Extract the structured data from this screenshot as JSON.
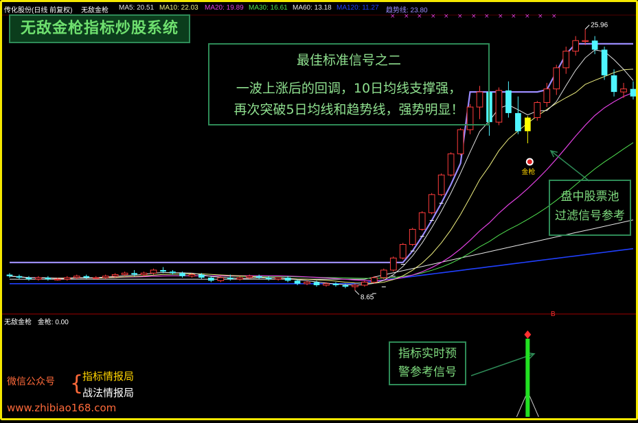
{
  "header": {
    "stock": "传化股份(日线 前复权)",
    "indicator": "无敌金枪",
    "ma5": "MA5: 20.51",
    "ma10": "MA10: 22.03",
    "ma20": "MA20: 19.89",
    "ma30": "MA30: 16.61",
    "ma60": "MA60: 13.18",
    "ma120": "MA120: 11.27",
    "trend": "趋势线: 23.80"
  },
  "sub_header": {
    "indicator": "无敌金枪",
    "value": "金枪: 0.00"
  },
  "title_banner": "无敌金枪指标炒股系统",
  "signal_box": {
    "title": "最佳标准信号之二",
    "line1": "一波上涨后的回调，10日均线支撑强，",
    "line2": "再次突破5日均线和趋势线，强势明显！"
  },
  "pool_box": {
    "line1": "盘中股票池",
    "line2": "过滤信号参考"
  },
  "warn_box": {
    "line1": "指标实时预",
    "line2": "警参考信号"
  },
  "promo": {
    "wechat": "微信公众号",
    "name1": "指标情报局",
    "name2": "战法情报局",
    "url": "www.zhibiao168.com"
  },
  "chart_data": {
    "type": "candlestick",
    "high_label": "25.96",
    "low_label": "8.65",
    "signal_label": "金枪",
    "sub_marker": "B",
    "colors": {
      "up": "#ff3c3c",
      "down": "#4ff5ff",
      "signal": "#ffff00",
      "ma5": "#e0e0e0",
      "ma10": "#f0f080",
      "ma20": "#e040e0",
      "ma30": "#50e050",
      "ma60": "#e8e8e8",
      "ma120": "#2040ff",
      "trend": "#9b8cff"
    },
    "candles": [
      [
        9.7,
        9.8,
        9.5,
        9.6
      ],
      [
        9.6,
        9.7,
        9.4,
        9.5
      ],
      [
        9.5,
        9.6,
        9.3,
        9.4
      ],
      [
        9.4,
        9.6,
        9.3,
        9.5
      ],
      [
        9.5,
        9.6,
        9.3,
        9.4
      ],
      [
        9.4,
        9.5,
        9.3,
        9.4
      ],
      [
        9.4,
        9.6,
        9.3,
        9.5
      ],
      [
        9.5,
        9.7,
        9.4,
        9.6
      ],
      [
        9.6,
        9.7,
        9.4,
        9.5
      ],
      [
        9.5,
        9.6,
        9.4,
        9.5
      ],
      [
        9.5,
        9.7,
        9.4,
        9.6
      ],
      [
        9.6,
        9.8,
        9.5,
        9.7
      ],
      [
        9.7,
        9.9,
        9.6,
        9.8
      ],
      [
        9.8,
        10.0,
        9.6,
        9.7
      ],
      [
        9.7,
        9.9,
        9.6,
        9.8
      ],
      [
        9.8,
        10.1,
        9.7,
        10.0
      ],
      [
        10.0,
        10.2,
        9.8,
        9.9
      ],
      [
        9.9,
        10.0,
        9.7,
        9.8
      ],
      [
        9.8,
        9.9,
        9.5,
        9.6
      ],
      [
        9.6,
        9.8,
        9.5,
        9.7
      ],
      [
        9.7,
        9.8,
        9.4,
        9.5
      ],
      [
        9.5,
        9.6,
        9.2,
        9.3
      ],
      [
        9.3,
        9.6,
        9.2,
        9.5
      ],
      [
        9.5,
        9.7,
        9.3,
        9.4
      ],
      [
        9.4,
        9.6,
        9.3,
        9.5
      ],
      [
        9.5,
        9.7,
        9.4,
        9.6
      ],
      [
        9.6,
        9.7,
        9.4,
        9.5
      ],
      [
        9.5,
        9.6,
        9.3,
        9.4
      ],
      [
        9.4,
        9.5,
        9.3,
        9.5
      ],
      [
        9.5,
        9.6,
        9.2,
        9.3
      ],
      [
        9.3,
        9.4,
        9.0,
        9.1
      ],
      [
        9.1,
        9.3,
        9.0,
        9.2
      ],
      [
        9.2,
        9.3,
        8.9,
        9.0
      ],
      [
        9.0,
        9.2,
        8.9,
        9.1
      ],
      [
        9.1,
        9.2,
        8.9,
        9.0
      ],
      [
        9.0,
        9.1,
        8.8,
        8.9
      ],
      [
        8.9,
        9.1,
        8.65,
        9.0
      ],
      [
        9.0,
        9.3,
        8.9,
        9.2
      ],
      [
        9.2,
        9.6,
        9.1,
        9.5
      ],
      [
        9.5,
        10.1,
        9.4,
        10.0
      ],
      [
        10.0,
        10.9,
        9.9,
        10.8
      ],
      [
        10.8,
        11.8,
        10.7,
        11.7
      ],
      [
        11.7,
        12.8,
        11.6,
        12.7
      ],
      [
        12.7,
        13.9,
        12.6,
        13.8
      ],
      [
        13.8,
        15.1,
        13.7,
        15.0
      ],
      [
        15.0,
        16.4,
        14.9,
        16.3
      ],
      [
        16.3,
        17.8,
        16.2,
        17.7
      ],
      [
        17.7,
        19.4,
        17.6,
        19.3
      ],
      [
        19.3,
        21.0,
        19.0,
        20.8
      ],
      [
        20.8,
        22.2,
        20.0,
        21.8
      ],
      [
        21.8,
        22.4,
        18.9,
        19.8
      ],
      [
        19.8,
        22.1,
        19.6,
        21.9
      ],
      [
        21.9,
        22.5,
        20.1,
        20.4
      ],
      [
        20.4,
        21.5,
        19.0,
        19.2
      ],
      [
        19.2,
        20.2,
        18.4,
        20.1
      ],
      [
        20.1,
        21.2,
        19.9,
        21.1
      ],
      [
        21.1,
        22.4,
        20.8,
        22.0
      ],
      [
        22.0,
        23.6,
        21.6,
        23.4
      ],
      [
        23.4,
        24.8,
        23.0,
        24.5
      ],
      [
        24.5,
        25.5,
        24.2,
        25.2
      ],
      [
        25.2,
        25.96,
        24.9,
        25.2
      ],
      [
        25.2,
        25.5,
        24.3,
        24.6
      ],
      [
        24.6,
        24.8,
        22.6,
        22.9
      ],
      [
        22.9,
        23.3,
        21.5,
        21.8
      ],
      [
        21.8,
        22.4,
        21.4,
        22.0
      ],
      [
        22.0,
        22.5,
        21.3,
        21.5
      ]
    ]
  }
}
